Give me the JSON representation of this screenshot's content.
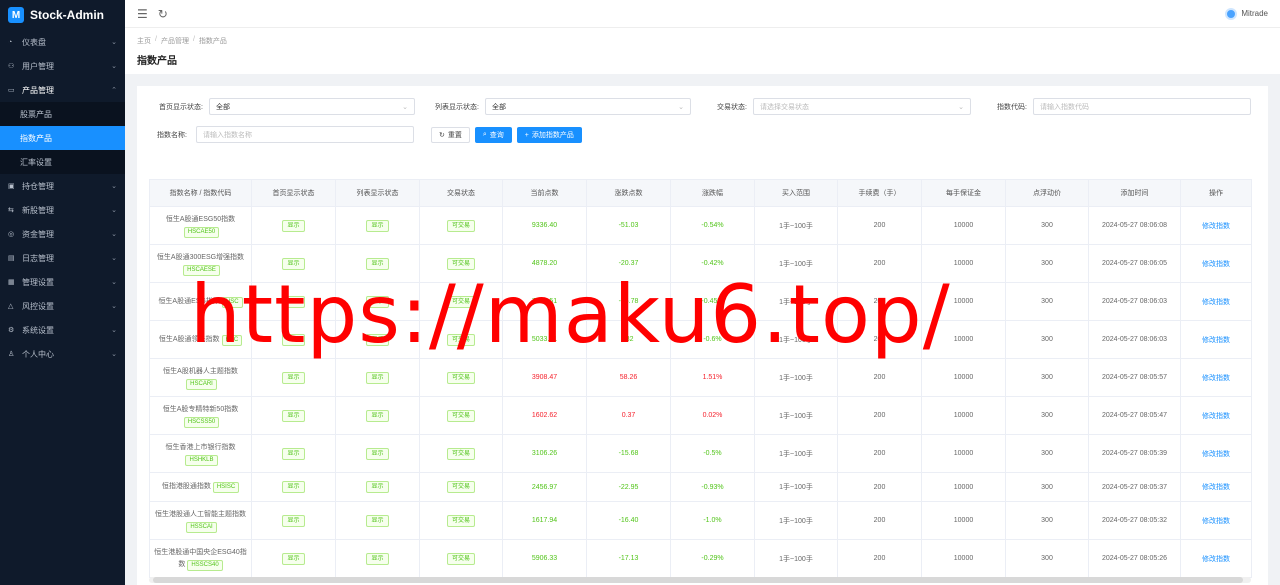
{
  "app": {
    "name": "Stock-Admin",
    "logo_text": "M"
  },
  "sidebar": {
    "items": [
      {
        "icon": "dashboard-icon",
        "glyph": "◔",
        "label": "仪表盘"
      },
      {
        "icon": "user-icon",
        "glyph": "⚇",
        "label": "用户管理"
      },
      {
        "icon": "product-icon",
        "glyph": "▭",
        "label": "产品管理",
        "open": true,
        "children": [
          {
            "label": "股票产品"
          },
          {
            "label": "指数产品",
            "active": true
          },
          {
            "label": "汇率设置"
          }
        ]
      },
      {
        "icon": "position-icon",
        "glyph": "▣",
        "label": "持仓管理"
      },
      {
        "icon": "ipo-icon",
        "glyph": "⇆",
        "label": "新股管理"
      },
      {
        "icon": "funds-icon",
        "glyph": "◎",
        "label": "资金管理"
      },
      {
        "icon": "log-icon",
        "glyph": "▤",
        "label": "日志管理"
      },
      {
        "icon": "admin-icon",
        "glyph": "▦",
        "label": "管理设置"
      },
      {
        "icon": "risk-icon",
        "glyph": "△",
        "label": "风控设置"
      },
      {
        "icon": "system-icon",
        "glyph": "⚙",
        "label": "系统设置"
      },
      {
        "icon": "profile-icon",
        "glyph": "♙",
        "label": "个人中心"
      }
    ]
  },
  "topbar": {
    "user_name": "Mitrade"
  },
  "breadcrumb": [
    "主页",
    "产品管理",
    "指数产品"
  ],
  "page_title": "指数产品",
  "filters": {
    "home_display": {
      "label": "首页显示状态:",
      "value": "全部"
    },
    "list_display": {
      "label": "列表显示状态:",
      "value": "全部"
    },
    "trade_status": {
      "label": "交易状态:",
      "placeholder": "请选择交易状态"
    },
    "index_code": {
      "label": "指数代码:",
      "placeholder": "请输入指数代码"
    },
    "index_name": {
      "label": "指数名称:",
      "placeholder": "请输入指数名称"
    },
    "reset_label": "重置",
    "search_label": "查询",
    "add_label": "添加指数产品"
  },
  "table": {
    "headers": [
      "指数名称 / 指数代码",
      "首页显示状态",
      "列表显示状态",
      "交易状态",
      "当前点数",
      "涨跌点数",
      "涨跌幅",
      "买入范围",
      "手续费（手）",
      "每手保证金",
      "点浮动价",
      "添加时间",
      "操作"
    ],
    "rows": [
      {
        "name": "恒生A股通ESG50指数",
        "code": "HSCAE50",
        "home": "显示",
        "list": "显示",
        "trade": "可交易",
        "points": "9336.40",
        "change": "-51.03",
        "pct": "-0.54%",
        "dir": "down",
        "range": "1手~100手",
        "fee": "200",
        "margin": "10000",
        "float": "300",
        "time": "2024-05-27 08:06:08",
        "action": "修改指数"
      },
      {
        "name": "恒生A股通300ESG增强指数",
        "code": "HSCAESE",
        "home": "显示",
        "list": "显示",
        "trade": "可交易",
        "points": "4878.20",
        "change": "-20.37",
        "pct": "-0.42%",
        "dir": "down",
        "range": "1手~100手",
        "fee": "200",
        "margin": "10000",
        "float": "300",
        "time": "2024-05-27 08:06:05",
        "action": "修改指数"
      },
      {
        "name": "恒生A股通ESG指数",
        "code": "HSC",
        "home": "显示",
        "list": "显示",
        "trade": "可交易",
        "points": "7900.51",
        "change": "-35.78",
        "pct": "-0.45%",
        "dir": "down",
        "range": "1手~100手",
        "fee": "200",
        "margin": "10000",
        "float": "300",
        "time": "2024-05-27 08:06:03",
        "action": "修改指数"
      },
      {
        "name": "恒生A股通领先指数",
        "code": "HSC",
        "home": "显示",
        "list": "显示",
        "trade": "可交易",
        "points": "5033.71",
        "change": "-32",
        "pct": "-0.6%",
        "dir": "down",
        "range": "1手~100手",
        "fee": "200",
        "margin": "10000",
        "float": "300",
        "time": "2024-05-27 08:06:03",
        "action": "修改指数"
      },
      {
        "name": "恒生A股机器人主题指数",
        "code": "HSCARI",
        "home": "显示",
        "list": "显示",
        "trade": "可交易",
        "points": "3908.47",
        "change": "58.26",
        "pct": "1.51%",
        "dir": "up",
        "range": "1手~100手",
        "fee": "200",
        "margin": "10000",
        "float": "300",
        "time": "2024-05-27 08:05:57",
        "action": "修改指数"
      },
      {
        "name": "恒生A股专精特新50指数",
        "code": "HSCSS50",
        "home": "显示",
        "list": "显示",
        "trade": "可交易",
        "points": "1602.62",
        "change": "0.37",
        "pct": "0.02%",
        "dir": "up",
        "range": "1手~100手",
        "fee": "200",
        "margin": "10000",
        "float": "300",
        "time": "2024-05-27 08:05:47",
        "action": "修改指数"
      },
      {
        "name": "恒生香港上市银行指数",
        "code": "HSHKLB",
        "home": "显示",
        "list": "显示",
        "trade": "可交易",
        "points": "3106.26",
        "change": "-15.68",
        "pct": "-0.5%",
        "dir": "down",
        "range": "1手~100手",
        "fee": "200",
        "margin": "10000",
        "float": "300",
        "time": "2024-05-27 08:05:39",
        "action": "修改指数"
      },
      {
        "name": "恒指港股通指数",
        "code": "HSISC",
        "home": "显示",
        "list": "显示",
        "trade": "可交易",
        "points": "2456.97",
        "change": "-22.95",
        "pct": "-0.93%",
        "dir": "down",
        "range": "1手~100手",
        "fee": "200",
        "margin": "10000",
        "float": "300",
        "time": "2024-05-27 08:05:37",
        "action": "修改指数"
      },
      {
        "name": "恒生港股通人工智能主题指数",
        "code": "HSSCAI",
        "home": "显示",
        "list": "显示",
        "trade": "可交易",
        "points": "1617.94",
        "change": "-16.40",
        "pct": "-1.0%",
        "dir": "down",
        "range": "1手~100手",
        "fee": "200",
        "margin": "10000",
        "float": "300",
        "time": "2024-05-27 08:05:32",
        "action": "修改指数"
      },
      {
        "name": "恒生港股通中国央企ESG40指数",
        "code": "HSSCS40",
        "home": "显示",
        "list": "显示",
        "trade": "可交易",
        "points": "5906.33",
        "change": "-17.13",
        "pct": "-0.29%",
        "dir": "down",
        "range": "1手~100手",
        "fee": "200",
        "margin": "10000",
        "float": "300",
        "time": "2024-05-27 08:05:26",
        "action": "修改指数"
      }
    ]
  },
  "watermark": "https://maku6.top/"
}
